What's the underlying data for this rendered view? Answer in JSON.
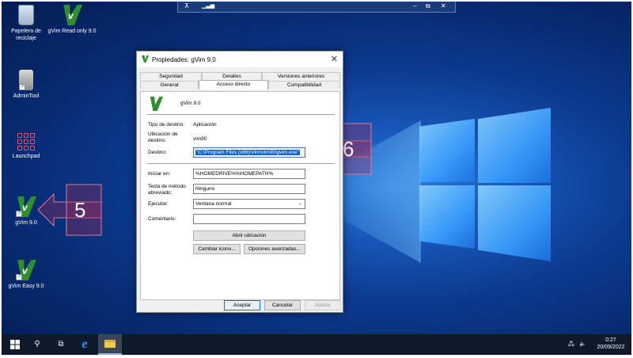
{
  "desktop": {
    "icons": [
      {
        "label": "Papelera de reciclaje",
        "icon": "recycle-bin-icon"
      },
      {
        "label": "gVim Read only 9.0",
        "icon": "gvim-icon"
      },
      {
        "label": "AdminTool",
        "icon": "admintool-icon"
      },
      {
        "label": "Launchpad",
        "icon": "launchpad-icon"
      },
      {
        "label": "gVim 9.0",
        "icon": "gvim-icon"
      },
      {
        "label": "gVim Easy 9.0",
        "icon": "gvim-icon"
      }
    ]
  },
  "callouts": {
    "step5": "5",
    "step6": "6",
    "color": "#a0285a"
  },
  "dialog": {
    "title": "Propiedades: gVim 9.0",
    "tabs_top": [
      "Seguridad",
      "Detalles",
      "Versiones anteriores"
    ],
    "tabs_bottom": [
      "General",
      "Acceso directo",
      "Compatibilidad"
    ],
    "active_tab": "Acceso directo",
    "app_name": "gVim 9.0",
    "fields": {
      "tipo_label": "Tipo de destino:",
      "tipo_value": "Aplicación",
      "ubicacion_label": "Ubicación de destino:",
      "ubicacion_value": "vim90",
      "destino_label": "Destino:",
      "destino_value": "\"C:\\Program Files (x86)\\Vim\\vim90\\gvim.exe\"",
      "iniciar_label": "Iniciar en:",
      "iniciar_value": "%HOMEDRIVE%%HOMEPATH%",
      "tecla_label": "Tecla de método abreviado:",
      "tecla_value": "Ninguno",
      "ejecutar_label": "Ejecutar:",
      "ejecutar_value": "Ventana normal",
      "comentario_label": "Comentario:",
      "comentario_value": ""
    },
    "buttons": {
      "abrir": "Abrir ubicación",
      "cambiar_icono": "Cambiar icono...",
      "opciones": "Opciones avanzadas...",
      "aceptar": "Aceptar",
      "cancelar": "Cancelar",
      "aplicar": "Aplicar"
    }
  },
  "taskbar": {
    "time": "0:27",
    "date": "20/09/2022"
  }
}
